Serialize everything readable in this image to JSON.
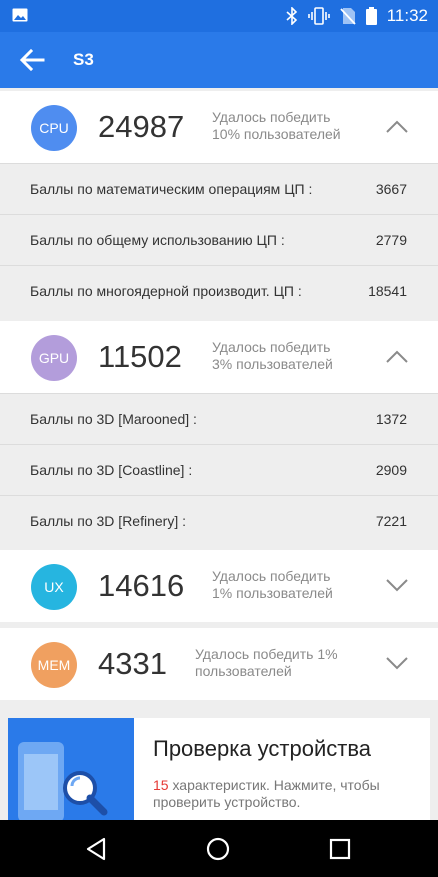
{
  "status": {
    "time": "11:32"
  },
  "appbar": {
    "title": "S3"
  },
  "cpu": {
    "badge": "CPU",
    "score": "24987",
    "beat_line1": "Удалось победить",
    "beat_line2": "10% пользователей",
    "expanded": true,
    "rows": [
      {
        "label": "Баллы по математическим операциям ЦП :",
        "value": "3667"
      },
      {
        "label": "Баллы по общему использованию ЦП :",
        "value": "2779"
      },
      {
        "label": "Баллы по многоядерной производит. ЦП :",
        "value": "18541"
      }
    ]
  },
  "gpu": {
    "badge": "GPU",
    "score": "11502",
    "beat_line1": "Удалось победить",
    "beat_line2": "3% пользователей",
    "expanded": true,
    "rows": [
      {
        "label": "Баллы по 3D [Marooned] :",
        "value": "1372"
      },
      {
        "label": "Баллы по 3D [Coastline] :",
        "value": "2909"
      },
      {
        "label": "Баллы по 3D [Refinery] :",
        "value": "7221"
      }
    ]
  },
  "ux": {
    "badge": "UX",
    "score": "14616",
    "beat_line1": "Удалось победить",
    "beat_line2": "1% пользователей",
    "expanded": false
  },
  "mem": {
    "badge": "MEM",
    "score": "4331",
    "beat_line1": "Удалось победить 1%",
    "beat_line2": "пользователей",
    "expanded": false
  },
  "promo": {
    "title": "Проверка устройства",
    "count": "15",
    "desc": " характеристик. Нажмите, чтобы проверить устройство."
  },
  "colors": {
    "appbar": "#2a7ae9",
    "statusbar": "#1f6fe0",
    "cpu": "#4f8df0",
    "gpu": "#b39ddb",
    "ux": "#26b5e0",
    "mem": "#f0a060",
    "highlight": "#e53935"
  },
  "icons": [
    "image-icon",
    "bluetooth-icon",
    "vibrate-icon",
    "no-sim-icon",
    "battery-icon",
    "back-arrow-icon",
    "chevron-up-icon",
    "chevron-down-icon",
    "phone-search-icon",
    "nav-back-icon",
    "nav-home-icon",
    "nav-recents-icon"
  ]
}
